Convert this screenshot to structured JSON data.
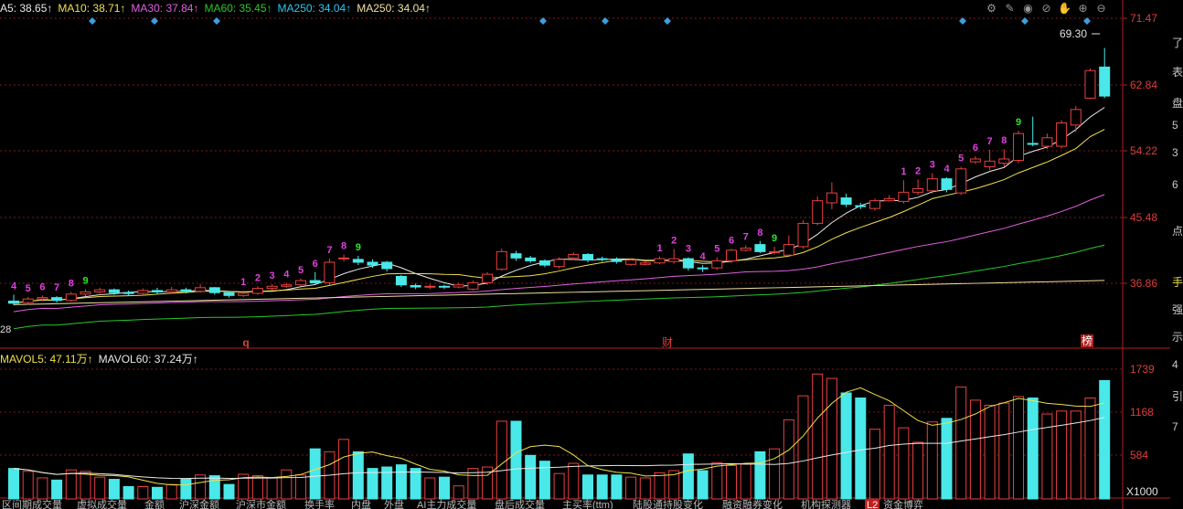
{
  "ma_legend": [
    {
      "label": "A5: 38.65↑",
      "color": "#e8e8e8"
    },
    {
      "label": "MA10: 38.71↑",
      "color": "#f0e04a"
    },
    {
      "label": "MA30: 37.84↑",
      "color": "#e060e0"
    },
    {
      "label": "MA60: 35.45↑",
      "color": "#28c828"
    },
    {
      "label": "MA250: 34.04↑",
      "color": "#28c8f0"
    },
    {
      "label": "MA250: 34.04↑",
      "color": "#f0e0a0"
    }
  ],
  "vol_legend": [
    {
      "label": "MAVOL5: 47.11万↑",
      "color": "#f0e04a"
    },
    {
      "label": "MAVOL60: 37.24万↑",
      "color": "#e8e8e8"
    }
  ],
  "price_axis": [
    "71.47",
    "62.84",
    "54.22",
    "45.48",
    "36.86"
  ],
  "volume_axis": [
    "1739",
    "1168",
    "584"
  ],
  "volume_unit": "X1000",
  "max_price_label": "69.30",
  "left_price_fragment": "28",
  "markers": {
    "q": "q",
    "cai": "财",
    "bang": "榜"
  },
  "right_strip": [
    "了",
    "表",
    "盘",
    "5",
    "3",
    "6",
    "点",
    "手",
    "强",
    "示",
    "4",
    "引",
    "7"
  ],
  "toolbar_icons": [
    "gear-icon",
    "pen-icon",
    "eye-icon",
    "eye-slash-icon",
    "hand-icon",
    "plus-circle-icon",
    "minus-circle-icon"
  ],
  "bottom_tabs": [
    "区间期成交量",
    "虚拟成交量",
    "金额",
    "沪深金额",
    "沪深市金额",
    "换手率",
    "内盘",
    "外盘",
    "AI主力成交量",
    "盘后成交量",
    "主买率(ttm)",
    "陆股通持股变化",
    "融资融券变化",
    "机构探测器",
    "资金博弈"
  ],
  "tab_badge": "L2",
  "chart_data": {
    "type": "candlestick",
    "price_range": [
      31.5,
      73.5
    ],
    "volume_range": [
      0,
      1900
    ],
    "candles": [
      [
        33.5,
        33.2,
        34.4,
        32.9,
        420
      ],
      [
        33.3,
        33.8,
        34.1,
        33.0,
        380
      ],
      [
        33.8,
        34.0,
        34.3,
        33.5,
        290
      ],
      [
        34.0,
        33.6,
        34.2,
        33.3,
        260
      ],
      [
        33.6,
        34.5,
        34.8,
        33.4,
        400
      ],
      [
        34.5,
        34.8,
        35.2,
        34.2,
        380
      ],
      [
        34.8,
        35.1,
        35.4,
        34.6,
        300
      ],
      [
        35.1,
        34.7,
        35.3,
        34.4,
        270
      ],
      [
        34.7,
        34.6,
        35.0,
        34.3,
        170
      ],
      [
        34.6,
        35.0,
        35.3,
        34.3,
        170
      ],
      [
        35.0,
        34.8,
        35.4,
        34.5,
        160
      ],
      [
        34.8,
        35.1,
        35.5,
        34.6,
        200
      ],
      [
        35.1,
        34.9,
        35.4,
        34.6,
        270
      ],
      [
        34.9,
        35.4,
        35.9,
        34.7,
        330
      ],
      [
        35.4,
        34.7,
        35.5,
        34.4,
        320
      ],
      [
        34.7,
        34.3,
        34.9,
        34.0,
        200
      ],
      [
        34.3,
        34.6,
        35.0,
        34.1,
        340
      ],
      [
        34.6,
        35.3,
        35.6,
        34.4,
        320
      ],
      [
        35.3,
        35.6,
        35.9,
        35.1,
        290
      ],
      [
        35.6,
        35.8,
        36.1,
        35.4,
        400
      ],
      [
        35.8,
        36.4,
        36.7,
        35.6,
        330
      ],
      [
        36.4,
        36.1,
        37.6,
        35.9,
        690
      ],
      [
        36.1,
        39.0,
        39.5,
        35.8,
        650
      ],
      [
        39.5,
        39.6,
        40.1,
        39.1,
        820
      ],
      [
        39.4,
        39.0,
        39.9,
        38.6,
        650
      ],
      [
        39.0,
        38.6,
        39.4,
        38.2,
        420
      ],
      [
        39.0,
        38.1,
        39.2,
        37.7,
        440
      ],
      [
        37.0,
        35.8,
        37.2,
        35.5,
        470
      ],
      [
        35.7,
        35.5,
        36.0,
        35.2,
        420
      ],
      [
        35.5,
        35.6,
        35.9,
        35.2,
        290
      ],
      [
        35.6,
        35.5,
        35.8,
        35.2,
        300
      ],
      [
        35.5,
        35.8,
        36.1,
        35.3,
        180
      ],
      [
        35.2,
        36.1,
        36.4,
        35.0,
        420
      ],
      [
        36.1,
        37.3,
        37.6,
        35.8,
        440
      ],
      [
        38.0,
        40.5,
        40.9,
        37.8,
        1070
      ],
      [
        40.2,
        39.6,
        40.6,
        39.2,
        1070
      ],
      [
        39.6,
        39.2,
        39.9,
        38.9,
        600
      ],
      [
        39.2,
        38.6,
        39.4,
        38.3,
        520
      ],
      [
        38.4,
        39.4,
        39.7,
        38.1,
        350
      ],
      [
        39.6,
        40.1,
        40.4,
        39.3,
        490
      ],
      [
        40.1,
        39.3,
        40.3,
        39.0,
        330
      ],
      [
        39.5,
        39.4,
        39.8,
        39.1,
        330
      ],
      [
        39.4,
        39.1,
        39.7,
        38.8,
        330
      ],
      [
        38.7,
        39.3,
        39.6,
        38.5,
        300
      ],
      [
        38.7,
        38.9,
        39.2,
        38.5,
        290
      ],
      [
        38.9,
        39.5,
        39.8,
        38.7,
        360
      ],
      [
        39.1,
        39.5,
        40.9,
        38.8,
        390
      ],
      [
        39.5,
        38.2,
        39.7,
        37.8,
        620
      ],
      [
        38.2,
        38.1,
        38.6,
        37.6,
        390
      ],
      [
        38.2,
        39.2,
        39.7,
        37.9,
        500
      ],
      [
        39.2,
        40.7,
        40.9,
        38.9,
        460
      ],
      [
        40.7,
        41.0,
        41.4,
        40.5,
        480
      ],
      [
        41.5,
        40.5,
        42.0,
        40.3,
        650
      ],
      [
        40.5,
        40.5,
        41.2,
        40.1,
        690
      ],
      [
        40.0,
        41.5,
        42.8,
        39.8,
        1090
      ],
      [
        41.2,
        44.5,
        44.9,
        40.9,
        1420
      ],
      [
        44.5,
        47.7,
        48.3,
        44.2,
        1720
      ],
      [
        47.4,
        48.8,
        50.3,
        46.5,
        1660
      ],
      [
        48.1,
        47.2,
        48.7,
        46.8,
        1460
      ],
      [
        47.0,
        46.9,
        47.4,
        46.5,
        1390
      ],
      [
        46.6,
        47.7,
        48.0,
        46.3,
        960
      ],
      [
        47.7,
        48.0,
        48.5,
        47.6,
        1290
      ],
      [
        47.6,
        48.9,
        50.6,
        47.3,
        980
      ],
      [
        48.9,
        49.4,
        50.7,
        48.5,
        780
      ],
      [
        49.1,
        50.8,
        51.6,
        48.7,
        1060
      ],
      [
        50.8,
        49.3,
        51.0,
        48.9,
        1110
      ],
      [
        48.8,
        52.2,
        52.5,
        48.5,
        1540
      ],
      [
        53.2,
        53.6,
        54.0,
        52.9,
        1360
      ],
      [
        52.5,
        53.3,
        54.9,
        52.0,
        1290
      ],
      [
        53.0,
        53.6,
        55.0,
        52.5,
        1320
      ],
      [
        53.4,
        57.2,
        57.6,
        53.0,
        1410
      ],
      [
        55.8,
        55.7,
        59.6,
        55.4,
        1390
      ],
      [
        55.4,
        56.6,
        57.2,
        55.0,
        1170
      ],
      [
        55.4,
        58.7,
        59.1,
        55.1,
        1210
      ],
      [
        58.4,
        60.6,
        61.1,
        57.4,
        1210
      ],
      [
        62.2,
        66.1,
        66.4,
        62.1,
        1390
      ],
      [
        66.6,
        62.5,
        69.3,
        62.2,
        1630
      ]
    ],
    "number_labels": [
      "4",
      "5",
      "6",
      "7",
      "8",
      "9",
      "1",
      "2",
      "3",
      "4",
      "5",
      "6",
      "7",
      "8",
      "9",
      "1",
      "2",
      "3",
      "4",
      "5",
      "6",
      "7",
      "8",
      "9",
      "1",
      "2",
      "3",
      "4",
      "5",
      "6",
      "7",
      "8",
      "9"
    ]
  }
}
